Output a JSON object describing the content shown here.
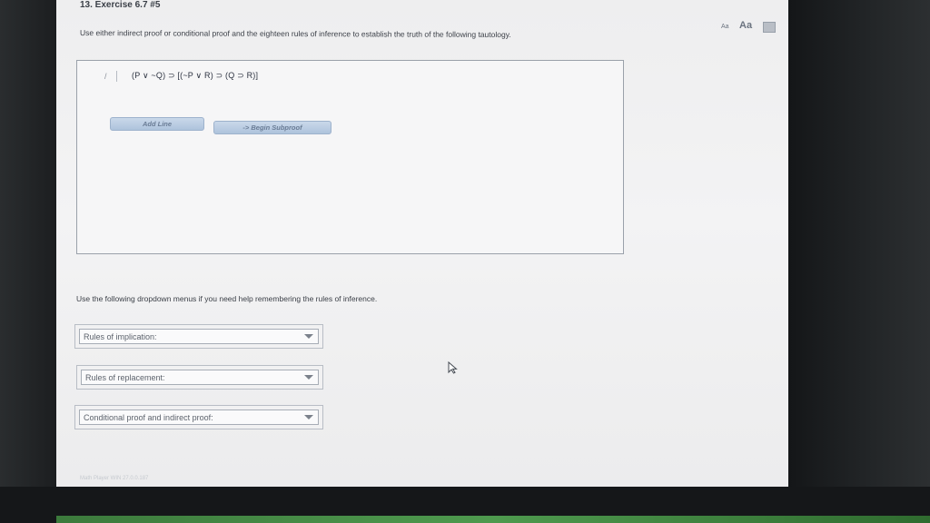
{
  "question": {
    "title": "13. Exercise 6.7 #5"
  },
  "toolbar": {
    "font_small_label": "Aa",
    "font_large_label": "Aa",
    "print_icon": "print-icon"
  },
  "instructions": "Use either indirect proof or conditional proof and the eighteen rules of inference to establish the truth of the following tautology.",
  "proof": {
    "line_number": "/",
    "formula": "(P ∨ ~Q) ⊃ [(~P ∨ R) ⊃ (Q ⊃ R)]",
    "add_line_label": "Add Line",
    "begin_subproof_label": "-> Begin Subproof"
  },
  "helper_text": "Use the following dropdown menus if you need help remembering the rules of inference.",
  "dropdowns": [
    {
      "label": "Rules of implication:"
    },
    {
      "label": "Rules of replacement:"
    },
    {
      "label": "Conditional proof and indirect proof:"
    }
  ],
  "footer": {
    "text": "Math Player WIN 27.0.0.187"
  }
}
